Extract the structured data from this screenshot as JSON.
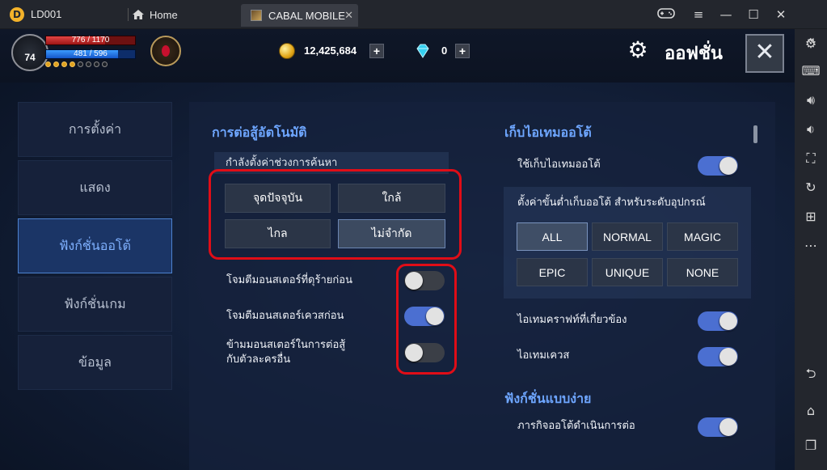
{
  "titlebar": {
    "app_name": "LD001",
    "home_label": "Home",
    "game_tab_label": "CABAL MOBILE",
    "tab_close": "✕"
  },
  "hud": {
    "level": "74",
    "hp_text": "776 / 1170",
    "hp_fraction": 0.66,
    "mp_text": "481 / 596",
    "mp_fraction": 0.81,
    "dots_on": 4,
    "dots_total": 8,
    "gold": "12,425,684",
    "gems": "0",
    "plus": "+",
    "title": "ออฟชั่น",
    "close_symbol": "✕"
  },
  "menu": [
    {
      "label": "การตั้งค่า",
      "active": false
    },
    {
      "label": "แสดง",
      "active": false
    },
    {
      "label": "ฟังก์ชั่นออโต้",
      "active": true
    },
    {
      "label": "ฟังก์ชั่นเกม",
      "active": false
    },
    {
      "label": "ข้อมูล",
      "active": false
    }
  ],
  "auto_combat": {
    "title": "การต่อสู้อัตโนมัติ",
    "search_range_label": "กำลังตั้งค่าช่วงการค้นหา",
    "range_options": [
      "จุดปัจจุบัน",
      "ใกล้",
      "ไกล",
      "ไม่จำกัด"
    ],
    "selected_range": "ไม่จำกัด",
    "toggles": [
      {
        "label": "โจมตีมอนสเตอร์ที่ดุร้ายก่อน",
        "on": false
      },
      {
        "label": "โจมตีมอนสเตอร์เควสก่อน",
        "on": true
      },
      {
        "label": "ข้ามมอนสเตอร์ในการต่อสู้",
        "label2": "กับตัวละครอื่น",
        "on": false
      }
    ]
  },
  "auto_loot": {
    "title": "เก็บไอเทมออโต้",
    "enable_label": "ใช้เก็บไอเทมออโต้",
    "enable_on": true,
    "grade_label": "ตั้งค่าขั้นต่ำเก็บออโต้ สำหรับระดับอุปกรณ์",
    "grades": [
      "ALL",
      "NORMAL",
      "MAGIC",
      "EPIC",
      "UNIQUE",
      "NONE"
    ],
    "selected_grade": "ALL",
    "craft_label": "ไอเทมคราฟท์ที่เกี่ยวข้อง",
    "craft_on": true,
    "quest_label": "ไอเทมเควส",
    "quest_on": true
  },
  "easy_func": {
    "title": "ฟังก์ชั่นแบบง่าย",
    "quest_continue_label": "ภารกิจออโต้ดำเนินการต่อ",
    "quest_continue_on": true
  },
  "colors": {
    "accent_blue": "#6ea6ff",
    "toggle_on": "#4b6fd1",
    "highlight_red": "#e00d17"
  }
}
